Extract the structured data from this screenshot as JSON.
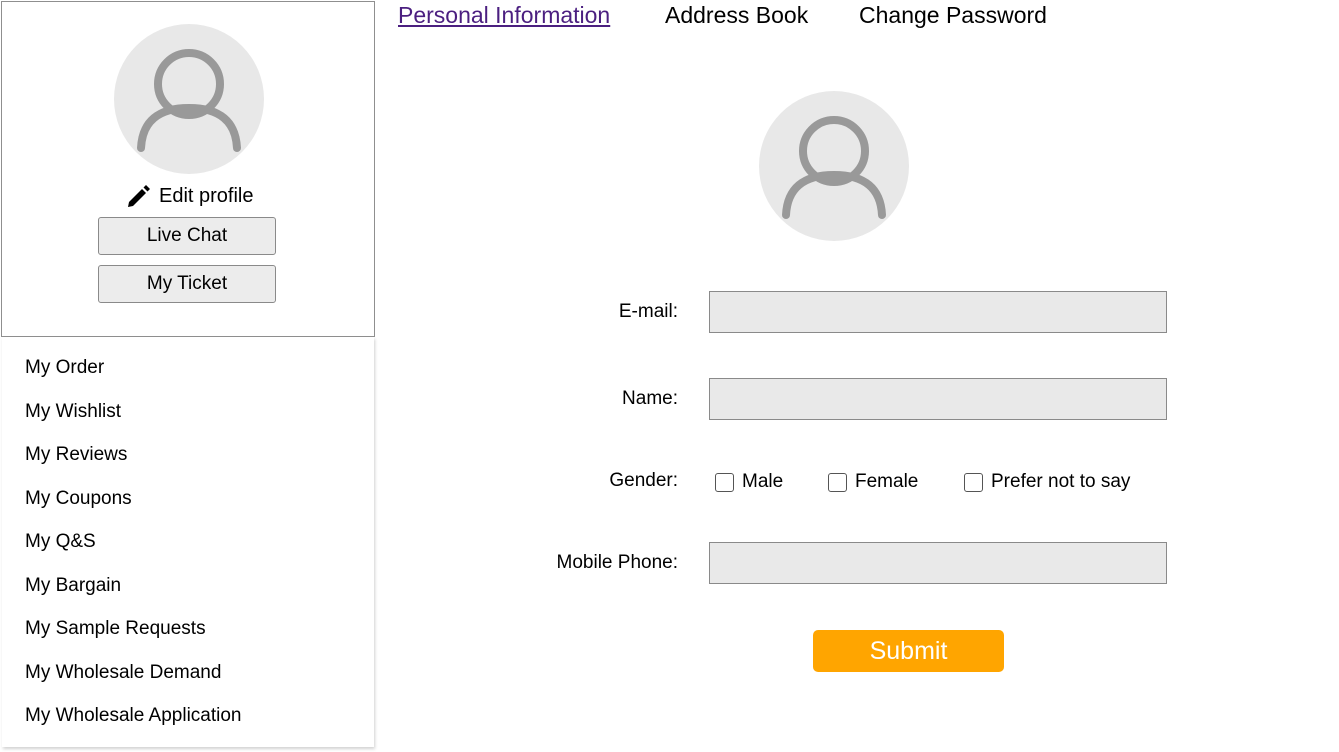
{
  "sidebar": {
    "edit_profile_label": "Edit profile",
    "live_chat_label": "Live Chat",
    "my_ticket_label": "My Ticket",
    "menu": [
      "My Order",
      "My Wishlist",
      "My Reviews",
      "My Coupons",
      "My Q&S",
      "My Bargain",
      "My Sample Requests",
      "My Wholesale Demand",
      "My Wholesale Application"
    ]
  },
  "tabs": [
    {
      "label": "Personal Information",
      "active": true
    },
    {
      "label": "Address Book",
      "active": false
    },
    {
      "label": "Change Password",
      "active": false
    }
  ],
  "form": {
    "email_label": "E-mail:",
    "email_value": "",
    "name_label": "Name:",
    "name_value": "",
    "gender_label": "Gender:",
    "gender_options": [
      "Male",
      "Female",
      "Prefer not to say"
    ],
    "mobile_label": "Mobile Phone:",
    "mobile_value": "",
    "submit_label": "Submit"
  },
  "icons": {
    "avatar": "user-avatar-icon",
    "edit": "pencil-icon",
    "checkbox": "checkbox-icon"
  },
  "colors": {
    "active_tab": "#4b1f80",
    "submit_bg": "#ffa500",
    "submit_text": "#ffffff",
    "input_bg": "#e9e9e9",
    "button_bg": "#ececec",
    "avatar_bg": "#e8e8e8",
    "avatar_stroke": "#999999"
  }
}
